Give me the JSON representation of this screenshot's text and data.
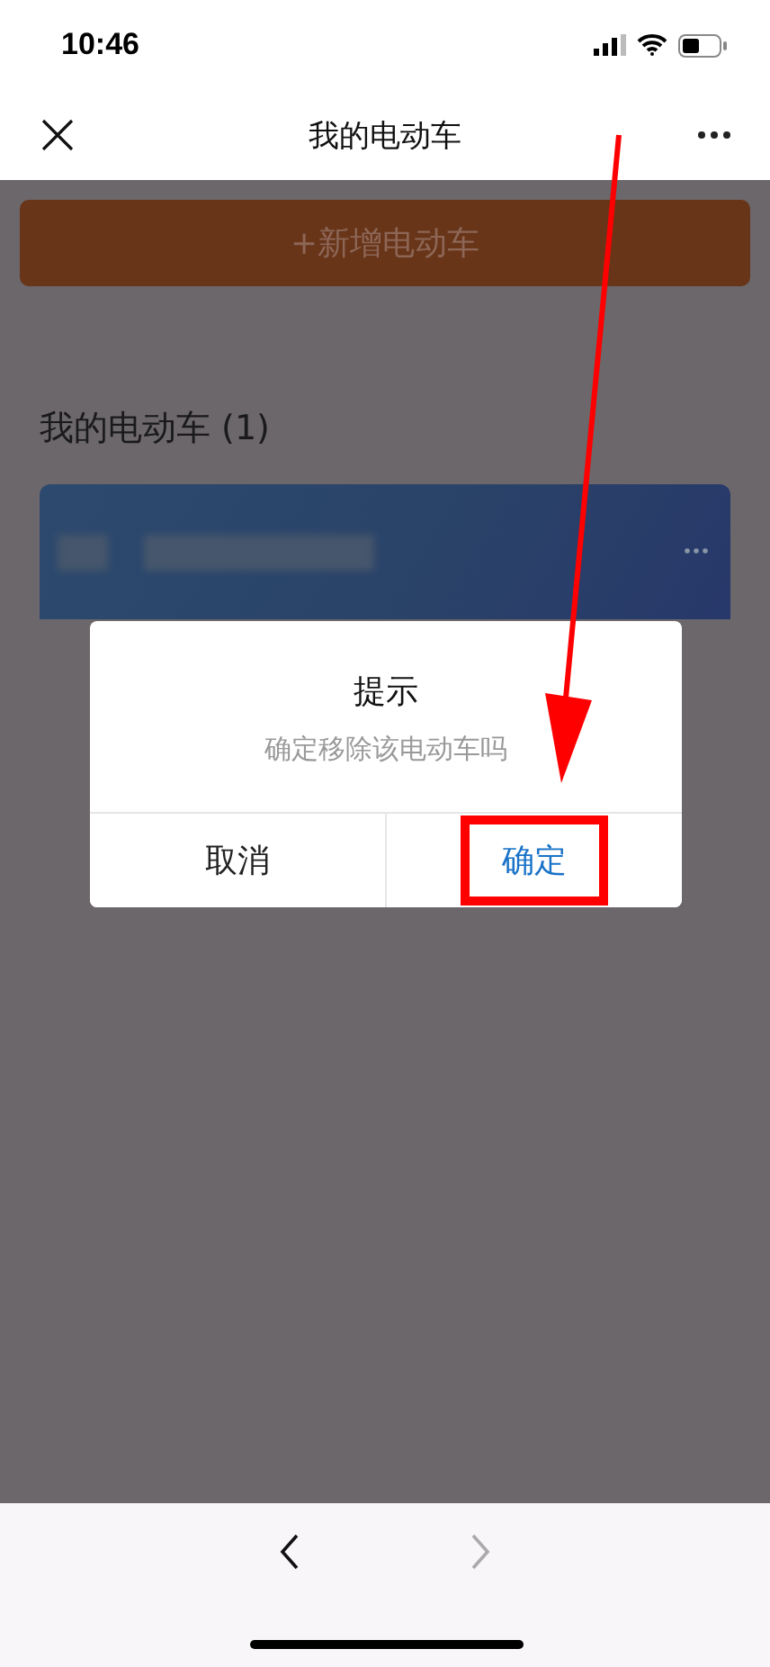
{
  "status_bar": {
    "time": "10:46"
  },
  "nav": {
    "title": "我的电动车"
  },
  "add_button": {
    "label": "+新增电动车"
  },
  "section": {
    "heading": "我的电动车 (1)"
  },
  "dialog": {
    "title": "提示",
    "message": "确定移除该电动车吗",
    "buttons": [
      {
        "label": "取消",
        "kind": "cancel",
        "highlighted": false
      },
      {
        "label": "确定",
        "kind": "confirm",
        "highlighted": true
      }
    ]
  },
  "toolbar": {
    "back": {
      "disabled": false
    },
    "forward": {
      "disabled": true
    }
  }
}
